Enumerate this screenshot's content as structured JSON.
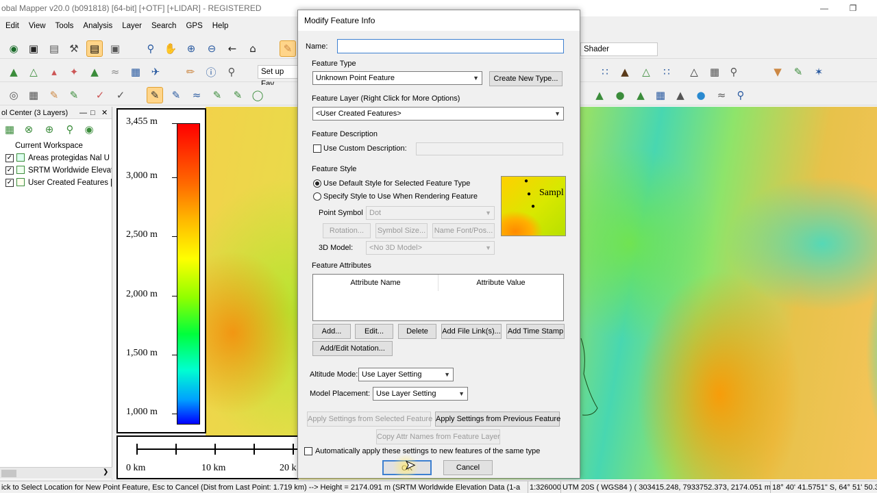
{
  "window": {
    "title": "obal Mapper v20.0 (b091818) [64-bit] [+OTF] [+LIDAR] - REGISTERED"
  },
  "menu": [
    "Edit",
    "View",
    "Tools",
    "Analysis",
    "Layer",
    "Search",
    "GPS",
    "Help"
  ],
  "toolbar": {
    "favorites_select": "Set up Fav",
    "shader_select": "Shader"
  },
  "control_center": {
    "title": "ol Center (3 Layers)",
    "workspace_label": "Current Workspace",
    "layers": [
      {
        "label": "Areas protegidas Nal U",
        "checked": true
      },
      {
        "label": "SRTM Worldwide Elevat",
        "checked": true
      },
      {
        "label": "User Created Features [",
        "checked": true
      }
    ]
  },
  "legend": {
    "labels": [
      "3,455 m",
      "3,000 m",
      "2,500 m",
      "2,000 m",
      "1,500 m",
      "1,000 m"
    ]
  },
  "scalebar": {
    "labels": [
      "0 km",
      "10 km",
      "20 k"
    ]
  },
  "dialog": {
    "title": "Modify Feature Info",
    "name_label": "Name:",
    "name_value": "",
    "feature_type_label": "Feature Type",
    "feature_type_value": "Unknown Point Feature",
    "create_type_button": "Create New Type...",
    "feature_layer_label": "Feature Layer (Right Click for More Options)",
    "feature_layer_value": "<User Created Features>",
    "description_label": "Feature Description",
    "custom_description_label": "Use Custom Description:",
    "style_label": "Feature Style",
    "default_style_label": "Use Default Style for Selected Feature Type",
    "specify_style_label": "Specify Style to Use When Rendering Feature",
    "point_symbol_label": "Point Symbol",
    "point_symbol_value": "Dot",
    "rotation_button": "Rotation...",
    "symbol_size_button": "Symbol Size...",
    "name_font_button": "Name Font/Pos...",
    "model_label": "3D Model:",
    "model_value": "<No 3D Model>",
    "sample_text": "Sampl",
    "attributes_label": "Feature Attributes",
    "attr_col_name": "Attribute Name",
    "attr_col_value": "Attribute Value",
    "add_button": "Add...",
    "edit_button": "Edit...",
    "delete_button": "Delete",
    "add_file_link_button": "Add File Link(s)...",
    "add_time_stamp_button": "Add Time Stamp",
    "add_notation_button": "Add/Edit Notation...",
    "altitude_mode_label": "Altitude Mode:",
    "altitude_mode_value": "Use Layer Setting",
    "model_placement_label": "Model Placement:",
    "model_placement_value": "Use Layer Setting",
    "apply_selected_button": "Apply Settings from Selected Feature",
    "apply_previous_button": "Apply Settings from Previous Feature",
    "copy_attr_button": "Copy Attr Names from Feature Layer",
    "auto_apply_label": "Automatically apply these settings to new features of the same type",
    "ok_button": "OK",
    "cancel_button": "Cancel"
  },
  "status": {
    "hint": "ick to Select Location for New Point Feature, Esc to Cancel (Dist from Last Point: 1.719 km) --> Height = 2174.091 m (SRTM Worldwide Elevation Data (1-a",
    "scale": "1:326000",
    "projection": "UTM 20S ( WGS84 ) ( 303415.248, 7933752.373, 2174.051 m )",
    "latlon": "18° 40' 41.5751\" S, 64° 51' 50.3"
  },
  "colors": {
    "accent_selected": "#ffd58a",
    "dialog_bg": "#f0f0f0",
    "focus_border": "#3c7fd0"
  }
}
